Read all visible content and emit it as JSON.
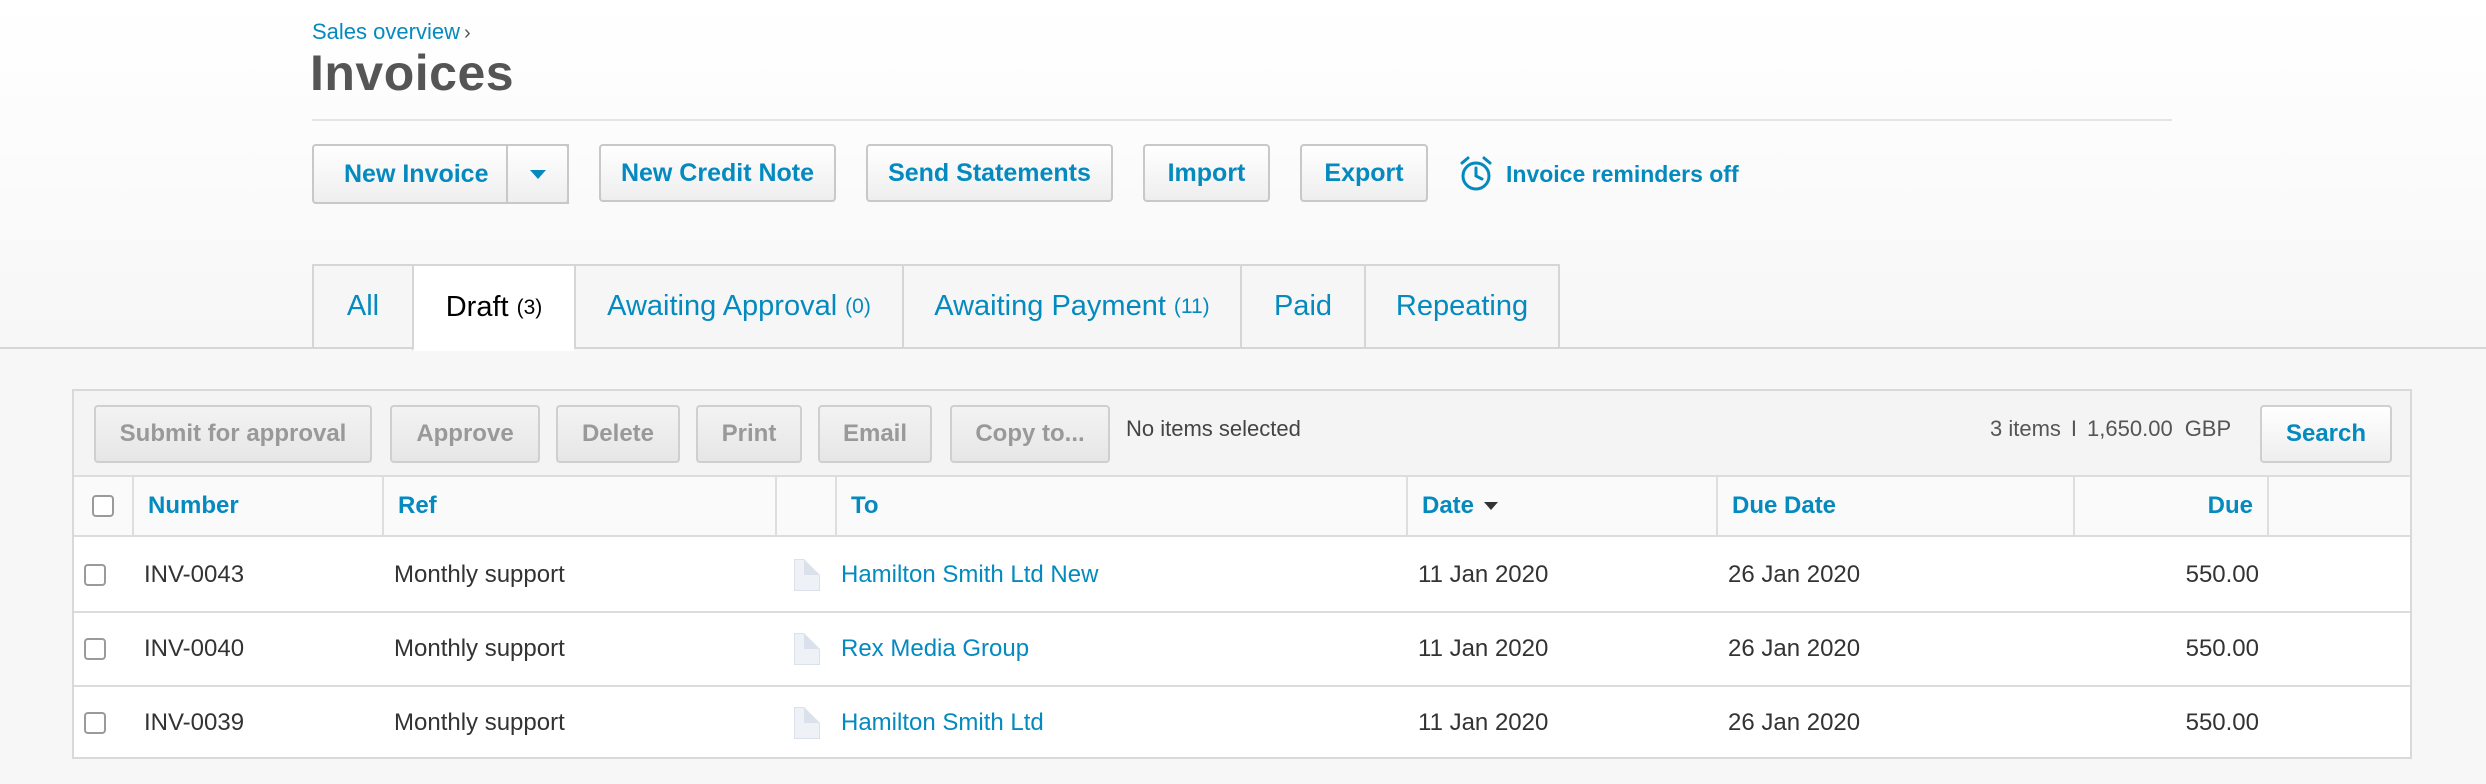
{
  "header": {
    "breadcrumb": "Sales overview",
    "breadcrumb_sep": "›",
    "title": "Invoices"
  },
  "toolbar": {
    "new_invoice": "New Invoice",
    "new_credit_note": "New Credit Note",
    "send_statements": "Send Statements",
    "import": "Import",
    "export": "Export",
    "reminders": "Invoice reminders off",
    "reminders_icon": "alarm-clock-icon"
  },
  "tabs": [
    {
      "label": "All",
      "count": ""
    },
    {
      "label": "Draft",
      "count": "(3)"
    },
    {
      "label": "Awaiting Approval",
      "count": "(0)"
    },
    {
      "label": "Awaiting Payment",
      "count": "(11)"
    },
    {
      "label": "Paid",
      "count": ""
    },
    {
      "label": "Repeating",
      "count": ""
    }
  ],
  "actions": {
    "submit": "Submit for approval",
    "approve": "Approve",
    "delete": "Delete",
    "print": "Print",
    "email": "Email",
    "copy": "Copy to...",
    "selection_status": "No items selected",
    "items": "3 items",
    "separator": "I",
    "total": "1,650.00",
    "currency": "GBP",
    "search": "Search"
  },
  "table": {
    "headers": {
      "number": "Number",
      "ref": "Ref",
      "to": "To",
      "date": "Date",
      "due_date": "Due Date",
      "due": "Due"
    },
    "rows": [
      {
        "number": "INV-0043",
        "ref": "Monthly support",
        "to": "Hamilton Smith Ltd New",
        "date": "11 Jan 2020",
        "due_date": "26 Jan 2020",
        "due": "550.00"
      },
      {
        "number": "INV-0040",
        "ref": "Monthly support",
        "to": "Rex Media Group",
        "date": "11 Jan 2020",
        "due_date": "26 Jan 2020",
        "due": "550.00"
      },
      {
        "number": "INV-0039",
        "ref": "Monthly support",
        "to": "Hamilton Smith Ltd",
        "date": "11 Jan 2020",
        "due_date": "26 Jan 2020",
        "due": "550.00"
      }
    ]
  },
  "colors": {
    "accent": "#048abf",
    "title": "#555555"
  }
}
